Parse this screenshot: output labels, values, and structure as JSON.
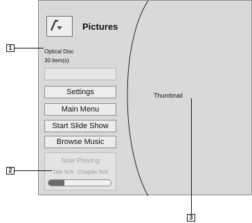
{
  "header": {
    "title": "Pictures",
    "icon": "picture-folder-icon"
  },
  "source": {
    "name": "Optical Disc",
    "count": "30 item(s)"
  },
  "menu": {
    "settings": "Settings",
    "main_menu": "Main Menu",
    "start_slide_show": "Start Slide Show",
    "browse_music": "Browse Music"
  },
  "now_playing": {
    "title": "Now Playing",
    "title_info": "Title N/A",
    "chapter_info": "Chapter N/A",
    "progress_fraction": 0.25
  },
  "preview": {
    "label": "Thumbnail"
  },
  "callouts": {
    "one": "1",
    "two": "2",
    "three": "3"
  }
}
